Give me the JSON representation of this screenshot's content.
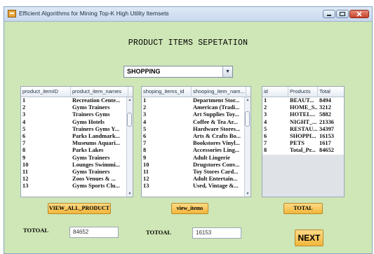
{
  "window": {
    "title": "Efficient Algorithms for Mining Top-K High Utility Itemsets",
    "controls": [
      "minimize",
      "maximize",
      "close"
    ]
  },
  "heading": "PRODUCT ITEMS SEPETATION",
  "category_select": {
    "value": "SHOPPING"
  },
  "table_left": {
    "columns": [
      "product_itemID",
      "product_item_names"
    ],
    "rows": [
      [
        "1",
        "Recreation Cente..."
      ],
      [
        "2",
        "Gyms Trainers"
      ],
      [
        "3",
        "Trainers Gyms"
      ],
      [
        "4",
        "Gyms Hotels"
      ],
      [
        "5",
        "Trainers Gyms Y..."
      ],
      [
        "6",
        "Parks Landmark..."
      ],
      [
        "7",
        "Museums Aquari..."
      ],
      [
        "8",
        "Parks Lakes"
      ],
      [
        "9",
        "Gyms Trainers"
      ],
      [
        "10",
        "Lounges Swimmi..."
      ],
      [
        "11",
        "Gyms Trainers"
      ],
      [
        "12",
        "Zoos Venues & ..."
      ],
      [
        "13",
        "Gyms Sports Clu..."
      ]
    ]
  },
  "table_middle": {
    "columns": [
      "shoping_items_id",
      "shooping_item_nam..."
    ],
    "rows": [
      [
        "1",
        "Department Stor..."
      ],
      [
        "2",
        "American (Tradi..."
      ],
      [
        "3",
        "Art Supplies Toy..."
      ],
      [
        "4",
        "Coffee & Tea Ar..."
      ],
      [
        "5",
        "Hardware Stores..."
      ],
      [
        "6",
        "Arts & Crafts Bo..."
      ],
      [
        "7",
        "Bookstores Vinyl..."
      ],
      [
        "8",
        "Accessories Ling..."
      ],
      [
        "9",
        "Adult Lingerie"
      ],
      [
        "10",
        "Drugstores Conv..."
      ],
      [
        "11",
        "Toy Stores Card..."
      ],
      [
        "12",
        "Adult Entertain..."
      ],
      [
        "13",
        "Used, Vintage &..."
      ]
    ]
  },
  "table_right": {
    "columns": [
      "id",
      "Products",
      "Total"
    ],
    "rows": [
      [
        "1",
        "BEAUT...",
        "8494"
      ],
      [
        "2",
        "HOME_S...",
        "3212"
      ],
      [
        "3",
        "HOTEL...",
        "5882"
      ],
      [
        "4",
        "NIGHT_...",
        "21336"
      ],
      [
        "5",
        "RESTAU...",
        "34397"
      ],
      [
        "6",
        "SHOPPI...",
        "16153"
      ],
      [
        "7",
        "PETS",
        "1617"
      ],
      [
        "8",
        "Total_Pr...",
        "84652"
      ]
    ]
  },
  "buttons": {
    "view_all_product": "VIEW_ALL_PRODUCT",
    "view_items": "view_items",
    "total": "TOTAL",
    "next": "NEXT"
  },
  "totals": {
    "label_left": "TOTOAL",
    "value_left": "84652",
    "label_middle": "TOTOAL",
    "value_middle": "16153"
  }
}
